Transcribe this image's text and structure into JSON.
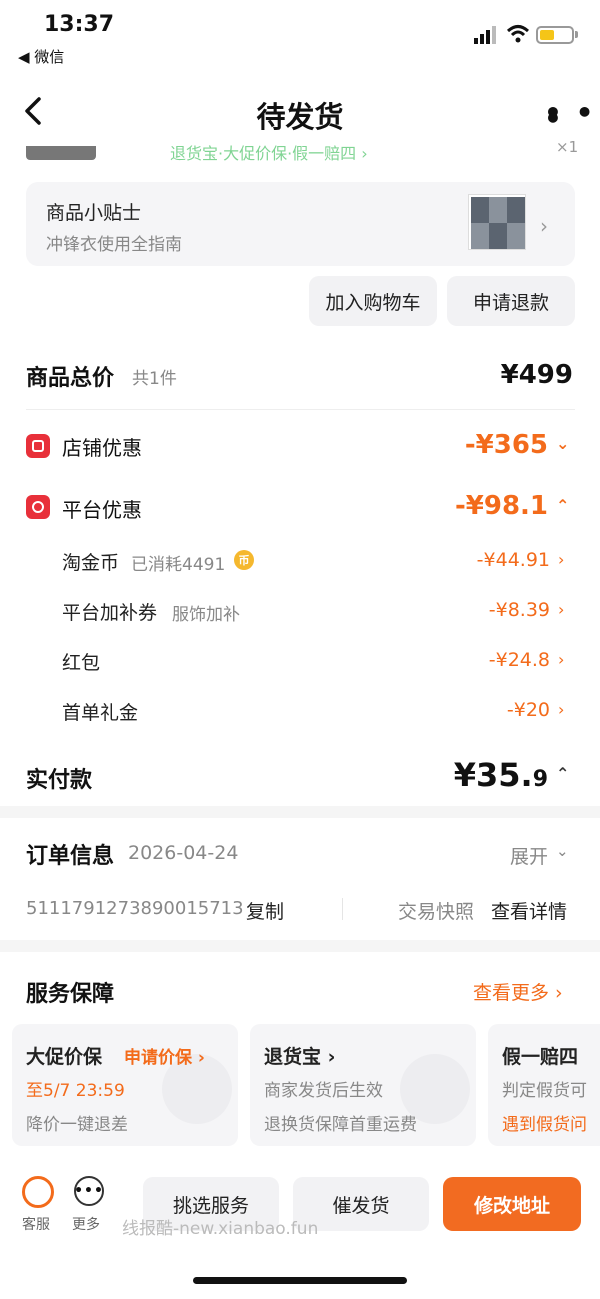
{
  "status_bar": {
    "time": "13:37",
    "back_app": "◀ 微信"
  },
  "nav": {
    "title": "待发货"
  },
  "clipped": {
    "text": "退货宝·大促价保·假一赔四 ›",
    "close": "×1"
  },
  "tips": {
    "title": "商品小贴士",
    "subtitle": "冲锋衣使用全指南"
  },
  "actions": {
    "cart": "加入购物车",
    "refund": "申请退款"
  },
  "total": {
    "label": "商品总价",
    "count": "共1件",
    "price": "¥499"
  },
  "shop_discount": {
    "label": "店铺优惠",
    "value": "-¥365"
  },
  "platform_discount": {
    "label": "平台优惠",
    "value": "-¥98.1"
  },
  "sub_items": [
    {
      "label": "淘金币",
      "note": "已消耗4491",
      "value": "-¥44.91"
    },
    {
      "label": "平台加补券",
      "note": "服饰加补",
      "value": "-¥8.39"
    },
    {
      "label": "红包",
      "note": "",
      "value": "-¥24.8"
    },
    {
      "label": "首单礼金",
      "note": "",
      "value": "-¥20"
    }
  ],
  "coin_icon": "币",
  "paid": {
    "label": "实付款",
    "main": "¥35.",
    "decimal": "9"
  },
  "order": {
    "title": "订单信息",
    "date": "2026-04-24",
    "expand": "展开",
    "number": "5111791273890015713",
    "copy": "复制",
    "snapshot": "交易快照",
    "details": "查看详情"
  },
  "service": {
    "title": "服务保障",
    "more": "查看更多 ›",
    "cards": [
      {
        "title": "大促价保",
        "action": "申请价保 ›",
        "line1": "至5/7 23:59",
        "line2": "降价一键退差"
      },
      {
        "title": "退货宝 ›",
        "line1": "商家发货后生效",
        "line2": "退换货保障首重运费"
      },
      {
        "title": "假一赔四",
        "line1": "判定假货可",
        "line2": "遇到假货问"
      }
    ]
  },
  "bottom": {
    "cs": "客服",
    "more": "更多",
    "pick": "挑选服务",
    "urge": "催发货",
    "address": "修改地址",
    "watermark": "线报酷-new.xianbao.fun"
  },
  "colors": {
    "accent": "#f36b1b",
    "badge_red": "#e8303a",
    "primary_button": "#f26b21"
  }
}
